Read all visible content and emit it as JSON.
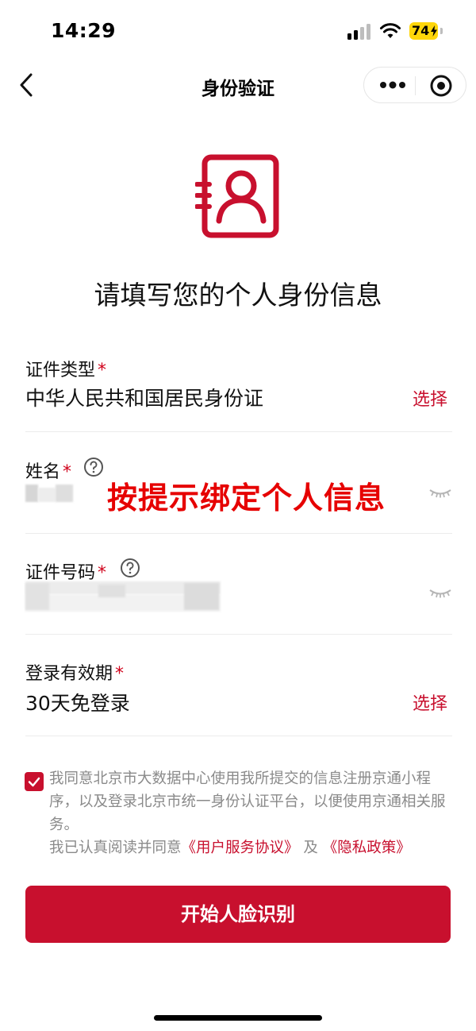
{
  "status_bar": {
    "time": "14:29",
    "battery": "74"
  },
  "nav": {
    "title": "身份验证"
  },
  "hero": {
    "title": "请填写您的个人身份信息"
  },
  "form": {
    "id_type": {
      "label": "证件类型",
      "required_mark": "*",
      "value": "中华人民共和国居民身份证",
      "action": "选择"
    },
    "name": {
      "label": "姓名",
      "required_mark": "*"
    },
    "id_number": {
      "label": "证件号码",
      "required_mark": "*"
    },
    "login_validity": {
      "label": "登录有效期",
      "required_mark": "*",
      "value": "30天免登录",
      "action": "选择"
    }
  },
  "overlay_hint": "按提示绑定个人信息",
  "agreement": {
    "line1": "我同意北京市大数据中心使用我所提交的信息注册京通小程序，以及登录北京市统一身份认证平台，以便使用京通相关服务。",
    "read_prefix": "我已认真阅读并同意",
    "user_agreement": "《用户服务协议》",
    "and": " 及 ",
    "privacy_policy": "《隐私政策》"
  },
  "primary_button": "开始人脸识别",
  "colors": {
    "accent": "#c8102e",
    "overlay_red": "#e60000",
    "battery_yellow": "#ffd60a"
  }
}
